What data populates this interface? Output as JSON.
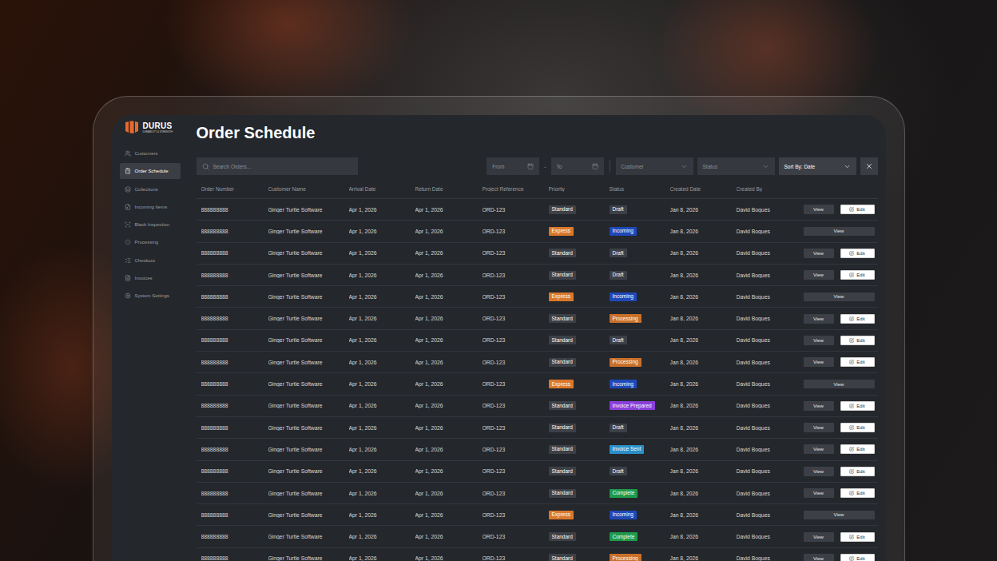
{
  "logo": {
    "name": "DURUS",
    "tagline": "DURABILITY & STRENGTH"
  },
  "sidebar": {
    "items": [
      {
        "label": "Customers",
        "selected": false
      },
      {
        "label": "Order Schedule",
        "selected": true
      },
      {
        "label": "Collections",
        "selected": false
      },
      {
        "label": "Incoming Items",
        "selected": false
      },
      {
        "label": "Black Inspection",
        "selected": false
      },
      {
        "label": "Processing",
        "selected": false
      },
      {
        "label": "Checkout",
        "selected": false
      },
      {
        "label": "Invoices",
        "selected": false
      },
      {
        "label": "System Settings",
        "selected": false
      }
    ]
  },
  "page": {
    "title": "Order Schedule"
  },
  "toolbar": {
    "search": {
      "placeholder": "Search Orders..."
    },
    "from": "From",
    "separator": "-",
    "to": "To",
    "customer": "Customer",
    "status": "Status",
    "sort": "Sort By: Date"
  },
  "table": {
    "columns": [
      "Order Number",
      "Customer Name",
      "Arrival Date",
      "Return Date",
      "Project Reference",
      "Priority",
      "Status",
      "Created Date",
      "Created By"
    ],
    "rows": [
      {
        "order": "888888888",
        "customer": "Ginger Turtle Software",
        "arrival": "Apr 1, 2026",
        "return": "Apr 1, 2026",
        "project": "ORD-123",
        "priority": {
          "label": "Standard",
          "color": "#3d4047"
        },
        "status": {
          "label": "Draft",
          "color": "#3d4047"
        },
        "created": "Jan 8, 2026",
        "createdBy": "David Bogues",
        "actions": [
          {
            "label": "View",
            "kind": "view"
          },
          {
            "label": "Edit",
            "kind": "edit"
          }
        ]
      },
      {
        "order": "888888888",
        "customer": "Ginger Turtle Software",
        "arrival": "Apr 1, 2026",
        "return": "Apr 1, 2026",
        "project": "ORD-123",
        "priority": {
          "label": "Express",
          "color": "#d9782b"
        },
        "status": {
          "label": "Incoming",
          "color": "#1f48b8"
        },
        "created": "Jan 8, 2026",
        "createdBy": "David Bogues",
        "actions": [
          {
            "label": "View",
            "kind": "wide"
          }
        ]
      },
      {
        "order": "888888888",
        "customer": "Ginger Turtle Software",
        "arrival": "Apr 1, 2026",
        "return": "Apr 1, 2026",
        "project": "ORD-123",
        "priority": {
          "label": "Standard",
          "color": "#3d4047"
        },
        "status": {
          "label": "Draft",
          "color": "#3d4047"
        },
        "created": "Jan 8, 2026",
        "createdBy": "David Bogues",
        "actions": [
          {
            "label": "View",
            "kind": "view"
          },
          {
            "label": "Edit",
            "kind": "edit"
          }
        ]
      },
      {
        "order": "888888888",
        "customer": "Ginger Turtle Software",
        "arrival": "Apr 1, 2026",
        "return": "Apr 1, 2026",
        "project": "ORD-123",
        "priority": {
          "label": "Standard",
          "color": "#3d4047"
        },
        "status": {
          "label": "Draft",
          "color": "#3d4047"
        },
        "created": "Jan 8, 2026",
        "createdBy": "David Bogues",
        "actions": [
          {
            "label": "View",
            "kind": "view"
          },
          {
            "label": "Edit",
            "kind": "edit"
          }
        ]
      },
      {
        "order": "888888888",
        "customer": "Ginger Turtle Software",
        "arrival": "Apr 1, 2026",
        "return": "Apr 1, 2026",
        "project": "ORD-123",
        "priority": {
          "label": "Express",
          "color": "#d9782b"
        },
        "status": {
          "label": "Incoming",
          "color": "#1f48b8"
        },
        "created": "Jan 8, 2026",
        "createdBy": "David Bogues",
        "actions": [
          {
            "label": "View",
            "kind": "wide"
          }
        ]
      },
      {
        "order": "888888888",
        "customer": "Ginger Turtle Software",
        "arrival": "Apr 1, 2026",
        "return": "Apr 1, 2026",
        "project": "ORD-123",
        "priority": {
          "label": "Standard",
          "color": "#3d4047"
        },
        "status": {
          "label": "Processing",
          "color": "#c8702a"
        },
        "created": "Jan 8, 2026",
        "createdBy": "David Bogues",
        "actions": [
          {
            "label": "View",
            "kind": "view"
          },
          {
            "label": "Edit",
            "kind": "edit"
          }
        ]
      },
      {
        "order": "888888888",
        "customer": "Ginger Turtle Software",
        "arrival": "Apr 1, 2026",
        "return": "Apr 1, 2026",
        "project": "ORD-123",
        "priority": {
          "label": "Standard",
          "color": "#3d4047"
        },
        "status": {
          "label": "Draft",
          "color": "#3d4047"
        },
        "created": "Jan 8, 2026",
        "createdBy": "David Bogues",
        "actions": [
          {
            "label": "View",
            "kind": "view"
          },
          {
            "label": "Edit",
            "kind": "edit"
          }
        ]
      },
      {
        "order": "888888888",
        "customer": "Ginger Turtle Software",
        "arrival": "Apr 1, 2026",
        "return": "Apr 1, 2026",
        "project": "ORD-123",
        "priority": {
          "label": "Standard",
          "color": "#3d4047"
        },
        "status": {
          "label": "Processing",
          "color": "#c8702a"
        },
        "created": "Jan 8, 2026",
        "createdBy": "David Bogues",
        "actions": [
          {
            "label": "View",
            "kind": "view"
          },
          {
            "label": "Edit",
            "kind": "edit"
          }
        ]
      },
      {
        "order": "888888888",
        "customer": "Ginger Turtle Software",
        "arrival": "Apr 1, 2026",
        "return": "Apr 1, 2026",
        "project": "ORD-123",
        "priority": {
          "label": "Express",
          "color": "#d9782b"
        },
        "status": {
          "label": "Incoming",
          "color": "#1f48b8"
        },
        "created": "Jan 8, 2026",
        "createdBy": "David Bogues",
        "actions": [
          {
            "label": "View",
            "kind": "wide"
          }
        ]
      },
      {
        "order": "888888888",
        "customer": "Ginger Turtle Software",
        "arrival": "Apr 1, 2026",
        "return": "Apr 1, 2026",
        "project": "ORD-123",
        "priority": {
          "label": "Standard",
          "color": "#3d4047"
        },
        "status": {
          "label": "Invoice Prepared",
          "color": "#8b3fd9"
        },
        "created": "Jan 8, 2026",
        "createdBy": "David Bogues",
        "actions": [
          {
            "label": "View",
            "kind": "view"
          },
          {
            "label": "Edit",
            "kind": "edit"
          }
        ]
      },
      {
        "order": "888888888",
        "customer": "Ginger Turtle Software",
        "arrival": "Apr 1, 2026",
        "return": "Apr 1, 2026",
        "project": "ORD-123",
        "priority": {
          "label": "Standard",
          "color": "#3d4047"
        },
        "status": {
          "label": "Draft",
          "color": "#3d4047"
        },
        "created": "Jan 8, 2026",
        "createdBy": "David Bogues",
        "actions": [
          {
            "label": "View",
            "kind": "view"
          },
          {
            "label": "Edit",
            "kind": "edit"
          }
        ]
      },
      {
        "order": "888888888",
        "customer": "Ginger Turtle Software",
        "arrival": "Apr 1, 2026",
        "return": "Apr 1, 2026",
        "project": "ORD-123",
        "priority": {
          "label": "Standard",
          "color": "#3d4047"
        },
        "status": {
          "label": "Invoice Sent",
          "color": "#2a8fc9"
        },
        "created": "Jan 8, 2026",
        "createdBy": "David Bogues",
        "actions": [
          {
            "label": "View",
            "kind": "view"
          },
          {
            "label": "Edit",
            "kind": "edit"
          }
        ]
      },
      {
        "order": "888888888",
        "customer": "Ginger Turtle Software",
        "arrival": "Apr 1, 2026",
        "return": "Apr 1, 2026",
        "project": "ORD-123",
        "priority": {
          "label": "Standard",
          "color": "#3d4047"
        },
        "status": {
          "label": "Draft",
          "color": "#3d4047"
        },
        "created": "Jan 8, 2026",
        "createdBy": "David Bogues",
        "actions": [
          {
            "label": "View",
            "kind": "view"
          },
          {
            "label": "Edit",
            "kind": "edit"
          }
        ]
      },
      {
        "order": "888888888",
        "customer": "Ginger Turtle Software",
        "arrival": "Apr 1, 2026",
        "return": "Apr 1, 2026",
        "project": "ORD-123",
        "priority": {
          "label": "Standard",
          "color": "#3d4047"
        },
        "status": {
          "label": "Complete",
          "color": "#1f9a4a"
        },
        "created": "Jan 8, 2026",
        "createdBy": "David Bogues",
        "actions": [
          {
            "label": "View",
            "kind": "view"
          },
          {
            "label": "Edit",
            "kind": "edit"
          }
        ]
      },
      {
        "order": "888888888",
        "customer": "Ginger Turtle Software",
        "arrival": "Apr 1, 2026",
        "return": "Apr 1, 2026",
        "project": "ORD-123",
        "priority": {
          "label": "Express",
          "color": "#d9782b"
        },
        "status": {
          "label": "Incoming",
          "color": "#1f48b8"
        },
        "created": "Jan 8, 2026",
        "createdBy": "David Bogues",
        "actions": [
          {
            "label": "View",
            "kind": "wide"
          }
        ]
      },
      {
        "order": "888888888",
        "customer": "Ginger Turtle Software",
        "arrival": "Apr 1, 2026",
        "return": "Apr 1, 2026",
        "project": "ORD-123",
        "priority": {
          "label": "Standard",
          "color": "#3d4047"
        },
        "status": {
          "label": "Complete",
          "color": "#1f9a4a"
        },
        "created": "Jan 8, 2026",
        "createdBy": "David Bogues",
        "actions": [
          {
            "label": "View",
            "kind": "view"
          },
          {
            "label": "Edit",
            "kind": "edit"
          }
        ]
      },
      {
        "order": "888888888",
        "customer": "Ginger Turtle Software",
        "arrival": "Apr 1, 2026",
        "return": "Apr 1, 2026",
        "project": "ORD-123",
        "priority": {
          "label": "Standard",
          "color": "#3d4047"
        },
        "status": {
          "label": "Processing",
          "color": "#c8702a"
        },
        "created": "Jan 8, 2026",
        "createdBy": "David Bogues",
        "actions": [
          {
            "label": "View",
            "kind": "view"
          },
          {
            "label": "Edit",
            "kind": "edit"
          }
        ]
      }
    ]
  }
}
